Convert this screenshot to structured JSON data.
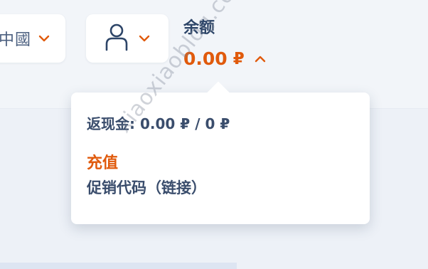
{
  "header": {
    "language": {
      "label": "中國",
      "icon": "chevron-down-icon"
    },
    "user_menu": {
      "icon": "user-icon",
      "chevron_icon": "chevron-down-icon"
    },
    "balance": {
      "label": "余额",
      "amount": "0.00",
      "currency": "₽",
      "toggle_icon": "chevron-up-icon"
    }
  },
  "balance_dropdown": {
    "cashback_label": "返现金:",
    "cashback_current": "0.00",
    "cashback_currency": "₽",
    "cashback_separator": "/",
    "cashback_total": "0",
    "cashback_total_currency": "₽",
    "recharge_label": "充值",
    "promo_code_label": "促销代码（链接）"
  },
  "watermark": "xiaoxiaoblog.com",
  "colors": {
    "accent": "#e05a0c",
    "text_primary": "#2d4568",
    "text_secondary": "#3a4d6c",
    "background": "#edf1f7",
    "card": "#ffffff"
  }
}
